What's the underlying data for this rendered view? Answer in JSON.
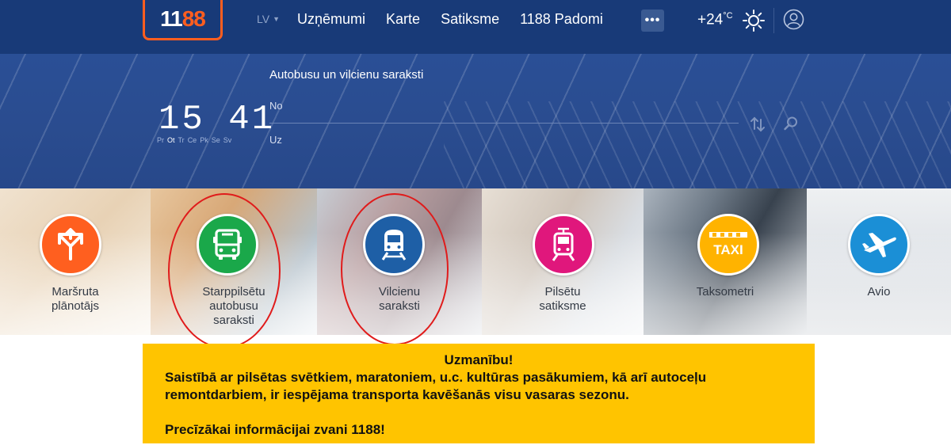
{
  "header": {
    "logo_white": "11",
    "logo_orange": "88",
    "language": "LV",
    "nav": [
      "Uzņēmumi",
      "Karte",
      "Satiksme",
      "1188 Padomi"
    ],
    "more_label": "•••",
    "temperature": "+24",
    "temperature_unit": "°C"
  },
  "hero": {
    "clock": "15 41",
    "days": [
      "Pr",
      "Ot",
      "Tr",
      "Ce",
      "Pk",
      "Se",
      "Sv"
    ],
    "active_day": "Ot",
    "search_title": "Autobusu un vilcienu saraksti",
    "from_label": "No",
    "to_label": "Uz"
  },
  "categories": [
    {
      "lines": [
        "Maršruta",
        "plānotājs"
      ],
      "color": "#ff5f1f",
      "icon": "route-arrows-icon"
    },
    {
      "lines": [
        "Starppilsētu",
        "autobusu",
        "saraksti"
      ],
      "color": "#1aa84a",
      "icon": "bus-icon"
    },
    {
      "lines": [
        "Vilcienu",
        "saraksti"
      ],
      "color": "#1e5fa6",
      "icon": "train-icon"
    },
    {
      "lines": [
        "Pilsētu",
        "satiksme"
      ],
      "color": "#e0177c",
      "icon": "tram-icon"
    },
    {
      "lines": [
        "Taksometri"
      ],
      "color": "#ffb300",
      "icon": "taxi-icon",
      "badge": "TAXI"
    },
    {
      "lines": [
        "Avio"
      ],
      "color": "#1b8fd6",
      "icon": "airplane-icon"
    }
  ],
  "notice": {
    "title": "Uzmanību!",
    "body": "Saistībā ar pilsētas svētkiem, maratoniem, u.c. kultūras pasākumiem, kā arī autoceļu remontdarbiem, ir iespējama transporta kavēšanās visu vasaras sezonu.",
    "footer": "Precīzākai informācijai zvani 1188!"
  },
  "colors": {
    "header_bg": "#183a78",
    "logo_accent": "#ff5e1f",
    "notice_bg": "#ffc400",
    "annotation": "#e01b1b"
  }
}
